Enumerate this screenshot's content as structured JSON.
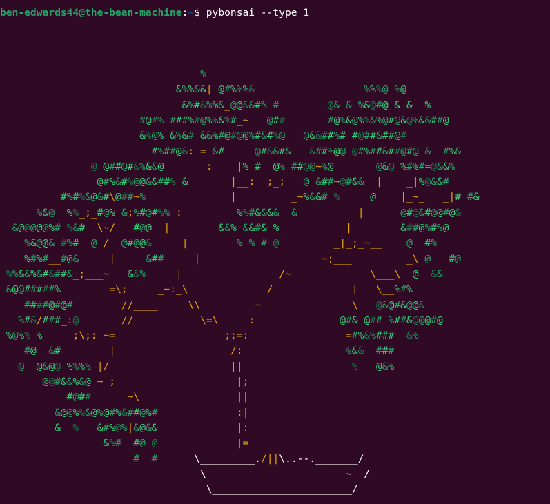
{
  "prompt": {
    "user_host": "ben-edwards44@the-bean-machine",
    "colon": ":",
    "path": "~",
    "symbol": "$",
    "command": " pybonsai --type 1"
  },
  "colors": {
    "background": "#300a24",
    "prompt_user": "#26a269",
    "prompt_path": "#12488b",
    "leaf_green": "#26a269",
    "leaf_bright": "#33d17a",
    "trunk": "#e5a50a",
    "pot": "#ffffff"
  },
  "tree_lines": [
    "                                 %",
    "                             &%%&&| @#%%%&                  %%%@ %@",
    "                              &%#&%%&_@@&&#% #        @& & %&@#@ & &  %",
    "                       #@#% ###%#@%%&%#_~   @##       #@%&@%%&%@#@&@%&&##@",
    "                       &%@%_&%&# &&%#@#@@%#&#%@   @&&##%# #@##&##@#",
    "                         #%##@&:_=_&#     @#&&#&   &##%@@_@#%##&##@#@ &  #%&",
    "               @ @##@#&%&&@       :    |% #  @% ##@@~%@ ___   @&@ %#%#=@&&%",
    "                @#%&#%@@&&##% &       |__:  ;_;   @ &##~@#&&  |    _|%@&&#",
    "          #%#%&@&#\\@##~%              |         _~%&&# %     @    |_~_   _|# #&",
    "      %&@  %%_;_#@% &;%#@#%% :         %%#&&&&  &          |      @#@&#@@#@&",
    "  &@@@@@%# %&#  \\~/   #@@  |        &&% &&#& %           |        &##@%#%@",
    "    %&@@& #%#  @ /  @#@@&     |        % % # @         _|_;_~__    @  #%",
    "    %#%#__#@&     |     &##     |                    ~;___         _\\ @   #@",
    " %%&&%&#&##&_;___~   &&%     |                /~             \\___\\  @  &&",
    " &@@#####%        =\\;     _~:_\\             /             |   \\__%#%",
    "    ####@#@#        //____     \\\\         ~               \\   @&@#&@@&",
    "   %#&/###_:@       //           \\=\\     :              @#& @## %##&@@@#@",
    " %@%% %     ;\\;:_~=                  ;;=:                =#%&%###  &%",
    "    #@  &#        |                   /:                 %&&  ###",
    "   @  @&@@ %%%% |/                    ||                  %   @&%",
    "       @@#&&%&@_~ ;                    |;",
    "           #@##      ~\\                ||",
    "         &@@%%&@%@#%&##@%#             :|",
    "         &  %   &#%@%|&@&&             |:",
    "                 &%#  #@ @             |=",
    "                      #  #      \\_________./||\\..--._______/",
    "                                 \\                       ~  /",
    "                                  \\_______________________/"
  ]
}
